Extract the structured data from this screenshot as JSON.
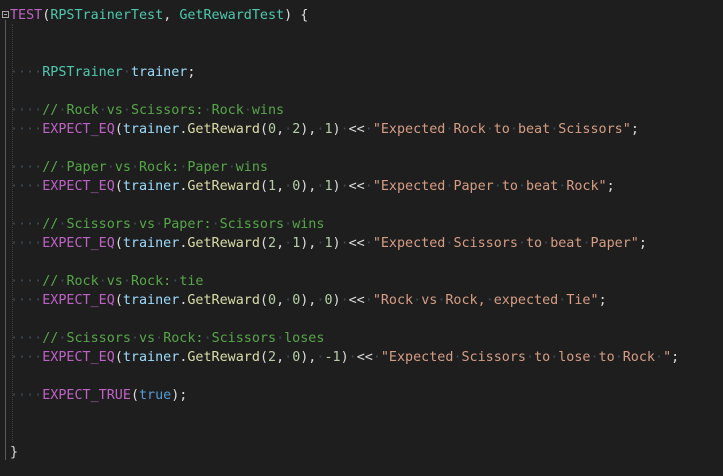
{
  "editor": {
    "background": "#1e1e1e",
    "lines": [
      {
        "indent": "",
        "tokens": [
          {
            "t": "TEST",
            "c": "macro"
          },
          {
            "t": "(",
            "c": "punc"
          },
          {
            "t": "RPSTrainerTest",
            "c": "type"
          },
          {
            "t": ", ",
            "c": "punc"
          },
          {
            "t": "GetRewardTest",
            "c": "type"
          },
          {
            "t": ") {",
            "c": "punc"
          }
        ]
      },
      {
        "indent": "",
        "tokens": []
      },
      {
        "indent": "",
        "tokens": []
      },
      {
        "indent": "····",
        "tokens": [
          {
            "t": "RPSTrainer",
            "c": "type"
          },
          {
            "t": "·",
            "c": "ws"
          },
          {
            "t": "trainer",
            "c": "var"
          },
          {
            "t": ";",
            "c": "punc"
          }
        ]
      },
      {
        "indent": "",
        "tokens": []
      },
      {
        "indent": "····",
        "tokens": [
          {
            "t": "//·Rock·vs·Scissors:·Rock·wins",
            "c": "cmt"
          }
        ]
      },
      {
        "indent": "····",
        "tokens": [
          {
            "t": "EXPECT_EQ",
            "c": "macro"
          },
          {
            "t": "(",
            "c": "punc"
          },
          {
            "t": "trainer",
            "c": "var"
          },
          {
            "t": ".",
            "c": "punc"
          },
          {
            "t": "GetReward",
            "c": "func"
          },
          {
            "t": "(",
            "c": "punc"
          },
          {
            "t": "0",
            "c": "num"
          },
          {
            "t": ",·",
            "c": "punc"
          },
          {
            "t": "2",
            "c": "num"
          },
          {
            "t": "),·",
            "c": "punc"
          },
          {
            "t": "1",
            "c": "num"
          },
          {
            "t": ")·<<·",
            "c": "punc"
          },
          {
            "t": "\"Expected·Rock·to·beat·Scissors\"",
            "c": "str"
          },
          {
            "t": ";",
            "c": "punc"
          }
        ]
      },
      {
        "indent": "",
        "tokens": []
      },
      {
        "indent": "····",
        "tokens": [
          {
            "t": "//·Paper·vs·Rock:·Paper·wins",
            "c": "cmt"
          }
        ]
      },
      {
        "indent": "····",
        "tokens": [
          {
            "t": "EXPECT_EQ",
            "c": "macro"
          },
          {
            "t": "(",
            "c": "punc"
          },
          {
            "t": "trainer",
            "c": "var"
          },
          {
            "t": ".",
            "c": "punc"
          },
          {
            "t": "GetReward",
            "c": "func"
          },
          {
            "t": "(",
            "c": "punc"
          },
          {
            "t": "1",
            "c": "num"
          },
          {
            "t": ",·",
            "c": "punc"
          },
          {
            "t": "0",
            "c": "num"
          },
          {
            "t": "),·",
            "c": "punc"
          },
          {
            "t": "1",
            "c": "num"
          },
          {
            "t": ")·<<·",
            "c": "punc"
          },
          {
            "t": "\"Expected·Paper·to·beat·Rock\"",
            "c": "str"
          },
          {
            "t": ";",
            "c": "punc"
          }
        ]
      },
      {
        "indent": "",
        "tokens": []
      },
      {
        "indent": "····",
        "tokens": [
          {
            "t": "//·Scissors·vs·Paper:·Scissors·wins",
            "c": "cmt"
          }
        ]
      },
      {
        "indent": "····",
        "tokens": [
          {
            "t": "EXPECT_EQ",
            "c": "macro"
          },
          {
            "t": "(",
            "c": "punc"
          },
          {
            "t": "trainer",
            "c": "var"
          },
          {
            "t": ".",
            "c": "punc"
          },
          {
            "t": "GetReward",
            "c": "func"
          },
          {
            "t": "(",
            "c": "punc"
          },
          {
            "t": "2",
            "c": "num"
          },
          {
            "t": ",·",
            "c": "punc"
          },
          {
            "t": "1",
            "c": "num"
          },
          {
            "t": "),·",
            "c": "punc"
          },
          {
            "t": "1",
            "c": "num"
          },
          {
            "t": ")·<<·",
            "c": "punc"
          },
          {
            "t": "\"Expected·Scissors·to·beat·Paper\"",
            "c": "str"
          },
          {
            "t": ";",
            "c": "punc"
          }
        ]
      },
      {
        "indent": "",
        "tokens": []
      },
      {
        "indent": "····",
        "tokens": [
          {
            "t": "//·Rock·vs·Rock:·tie",
            "c": "cmt"
          }
        ]
      },
      {
        "indent": "····",
        "tokens": [
          {
            "t": "EXPECT_EQ",
            "c": "macro"
          },
          {
            "t": "(",
            "c": "punc"
          },
          {
            "t": "trainer",
            "c": "var"
          },
          {
            "t": ".",
            "c": "punc"
          },
          {
            "t": "GetReward",
            "c": "func"
          },
          {
            "t": "(",
            "c": "punc"
          },
          {
            "t": "0",
            "c": "num"
          },
          {
            "t": ",·",
            "c": "punc"
          },
          {
            "t": "0",
            "c": "num"
          },
          {
            "t": "),·",
            "c": "punc"
          },
          {
            "t": "0",
            "c": "num"
          },
          {
            "t": ")·<<·",
            "c": "punc"
          },
          {
            "t": "\"Rock·vs·Rock,·expected·Tie\"",
            "c": "str"
          },
          {
            "t": ";",
            "c": "punc"
          }
        ]
      },
      {
        "indent": "",
        "tokens": []
      },
      {
        "indent": "····",
        "tokens": [
          {
            "t": "//·Scissors·vs·Rock:·Scissors·loses",
            "c": "cmt"
          }
        ]
      },
      {
        "indent": "····",
        "tokens": [
          {
            "t": "EXPECT_EQ",
            "c": "macro"
          },
          {
            "t": "(",
            "c": "punc"
          },
          {
            "t": "trainer",
            "c": "var"
          },
          {
            "t": ".",
            "c": "punc"
          },
          {
            "t": "GetReward",
            "c": "func"
          },
          {
            "t": "(",
            "c": "punc"
          },
          {
            "t": "2",
            "c": "num"
          },
          {
            "t": ",·",
            "c": "punc"
          },
          {
            "t": "0",
            "c": "num"
          },
          {
            "t": "),·",
            "c": "punc"
          },
          {
            "t": "-1",
            "c": "num"
          },
          {
            "t": ")·<<·",
            "c": "punc"
          },
          {
            "t": "\"Expected·Scissors·to·lose·to·Rock·\"",
            "c": "str"
          },
          {
            "t": ";",
            "c": "punc"
          }
        ]
      },
      {
        "indent": "",
        "tokens": []
      },
      {
        "indent": "····",
        "tokens": [
          {
            "t": "EXPECT_TRUE",
            "c": "macro"
          },
          {
            "t": "(",
            "c": "punc"
          },
          {
            "t": "true",
            "c": "kw"
          },
          {
            "t": ");",
            "c": "punc"
          }
        ]
      },
      {
        "indent": "",
        "tokens": []
      },
      {
        "indent": "",
        "tokens": []
      },
      {
        "indent": "",
        "tokens": [
          {
            "t": "}",
            "c": "punc"
          }
        ]
      }
    ]
  }
}
